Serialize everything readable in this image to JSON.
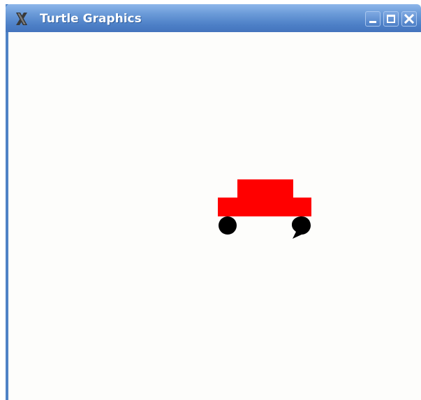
{
  "window": {
    "title": "Turtle Graphics",
    "icon": "x-window-icon",
    "controls": {
      "minimize_icon": "minimize-icon",
      "maximize_icon": "maximize-icon",
      "close_icon": "close-icon"
    },
    "colors": {
      "titlebar": "#4c7fc6",
      "canvas_background": "#fdfdfb"
    }
  },
  "drawing": {
    "car_body_color": "#ff0000",
    "wheel_color": "#000000"
  }
}
